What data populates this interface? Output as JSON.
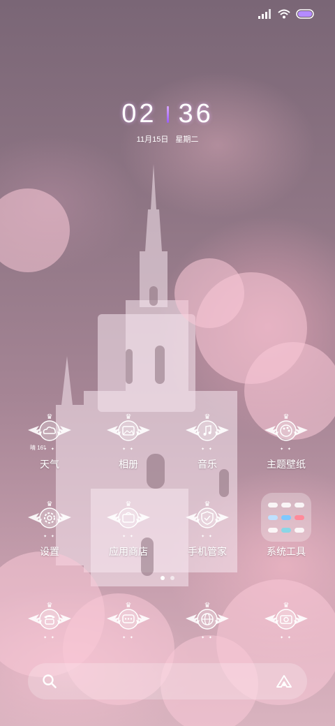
{
  "status_bar": {
    "signal_icon": "signal-icon",
    "wifi_icon": "wifi-icon",
    "battery_icon": "battery-icon",
    "battery_color": "#b48bff"
  },
  "clock": {
    "hours": "02",
    "minutes": "36",
    "date": "11月15日",
    "weekday": "星期二"
  },
  "apps": [
    {
      "label": "天气",
      "icon": "cloud-icon",
      "temp": "晴 16°"
    },
    {
      "label": "相册",
      "icon": "image-icon"
    },
    {
      "label": "音乐",
      "icon": "music-note-icon"
    },
    {
      "label": "主题壁纸",
      "icon": "palette-icon"
    },
    {
      "label": "设置",
      "icon": "gear-icon"
    },
    {
      "label": "应用商店",
      "icon": "store-icon"
    },
    {
      "label": "手机管家",
      "icon": "shield-check-icon"
    },
    {
      "label": "系统工具",
      "icon": "folder-icon"
    }
  ],
  "dock": [
    {
      "icon": "phone-icon"
    },
    {
      "icon": "message-icon"
    },
    {
      "icon": "globe-icon"
    },
    {
      "icon": "camera-icon"
    }
  ],
  "page_indicator": {
    "pages": 2,
    "active": 1
  },
  "search": {
    "search_icon": "search-icon",
    "assistant_icon": "assistant-icon"
  }
}
